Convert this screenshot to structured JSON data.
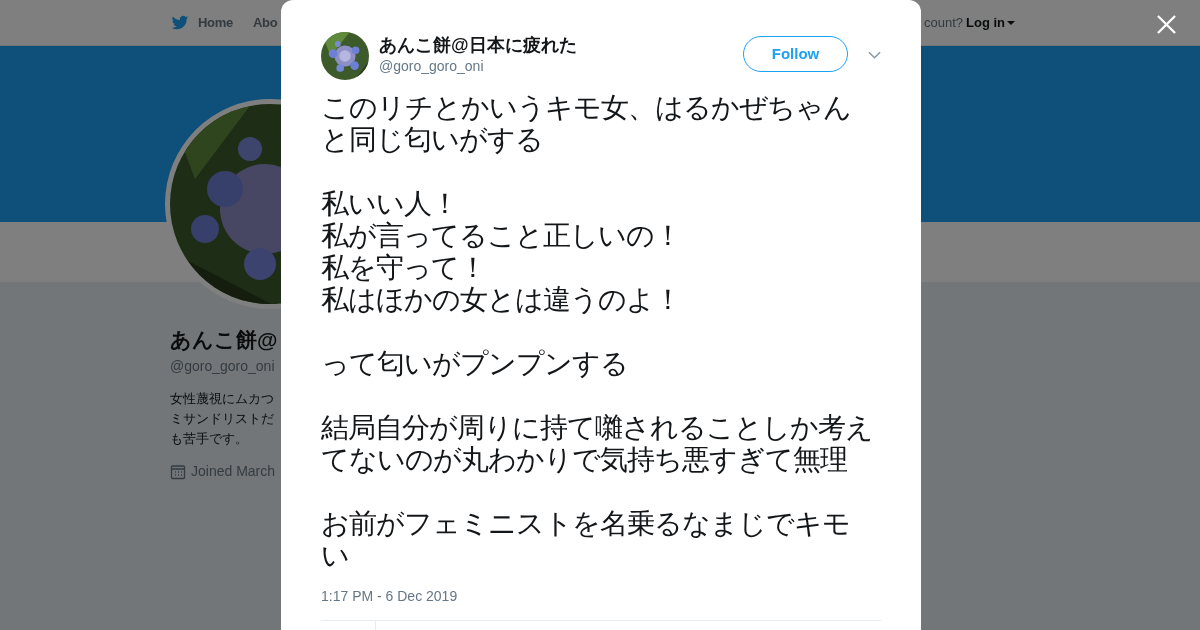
{
  "background_page": {
    "nav": {
      "items": [
        "Home",
        "Abo"
      ],
      "account_prompt": "count?",
      "login": "Log in"
    },
    "profile": {
      "name": "あんこ餅@",
      "handle": "@goro_goro_oni",
      "bio_lines": [
        "女性蔑視にムカつ",
        "ミサンドリストだ",
        "も苦手です。"
      ],
      "joined": "Joined March"
    }
  },
  "tweet": {
    "author": {
      "name": "あんこ餅@日本に疲れた",
      "handle": "@goro_goro_oni"
    },
    "follow_button": "Follow",
    "paragraphs": [
      [
        "このリチとかいうキモ女、はるかぜちゃん",
        "と同じ匂いがする"
      ],
      [
        "私いい人！",
        "私が言ってること正しいの！",
        "私を守って！",
        "私はほかの女とは違うのよ！"
      ],
      [
        "って匂いがプンプンする"
      ],
      [
        "結局自分が周りに持て囃されることしか考え",
        "てないのが丸わかりで気持ち悪すぎて無理"
      ],
      [
        "お前がフェミニストを名乗るなまじでキモ",
        "い"
      ]
    ],
    "timestamp": "1:17 PM - 6 Dec 2019"
  }
}
